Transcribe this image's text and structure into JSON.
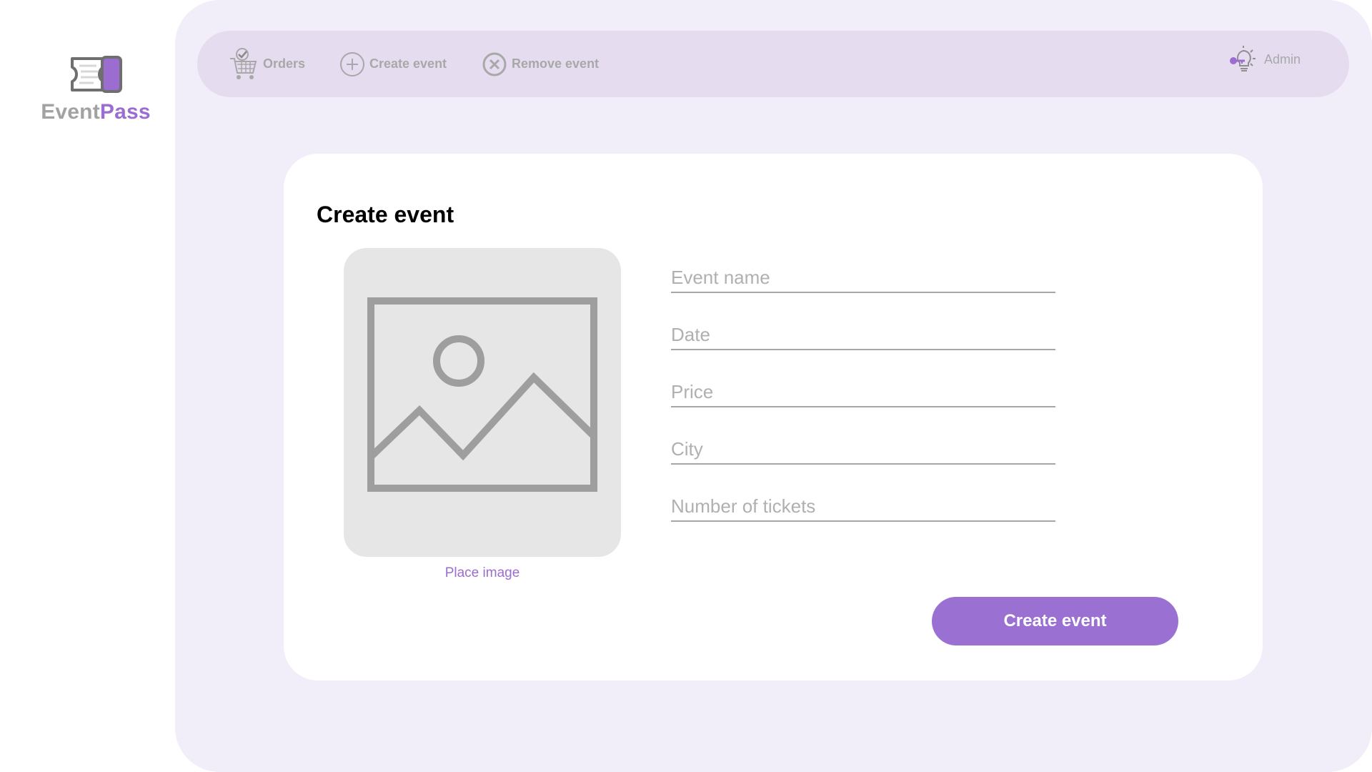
{
  "brand": {
    "name_part1": "Event",
    "name_part2": "Pass",
    "logo_icon": "ticket-icon"
  },
  "nav": {
    "orders_label": "Orders",
    "orders_icon": "cart-icon",
    "create_label": "Create event",
    "create_icon": "plus-circle-icon",
    "remove_label": "Remove event",
    "remove_icon": "x-circle-icon",
    "admin_label": "Admin",
    "admin_icon": "lightbulb-key-icon"
  },
  "form": {
    "title": "Create event",
    "image_placeholder_icon": "image-icon",
    "place_image_label": "Place image",
    "fields": {
      "event_name": {
        "placeholder": "Event name",
        "value": ""
      },
      "date": {
        "placeholder": "Date",
        "value": ""
      },
      "price": {
        "placeholder": "Price",
        "value": ""
      },
      "city": {
        "placeholder": "City",
        "value": ""
      },
      "tickets": {
        "placeholder": "Number of tickets",
        "value": ""
      }
    },
    "submit_label": "Create event"
  },
  "colors": {
    "accent": "#9b70d3",
    "panel_bg": "#f1edf9",
    "topbar_bg": "#e5dcf0",
    "muted_text": "#a8a8a8"
  }
}
